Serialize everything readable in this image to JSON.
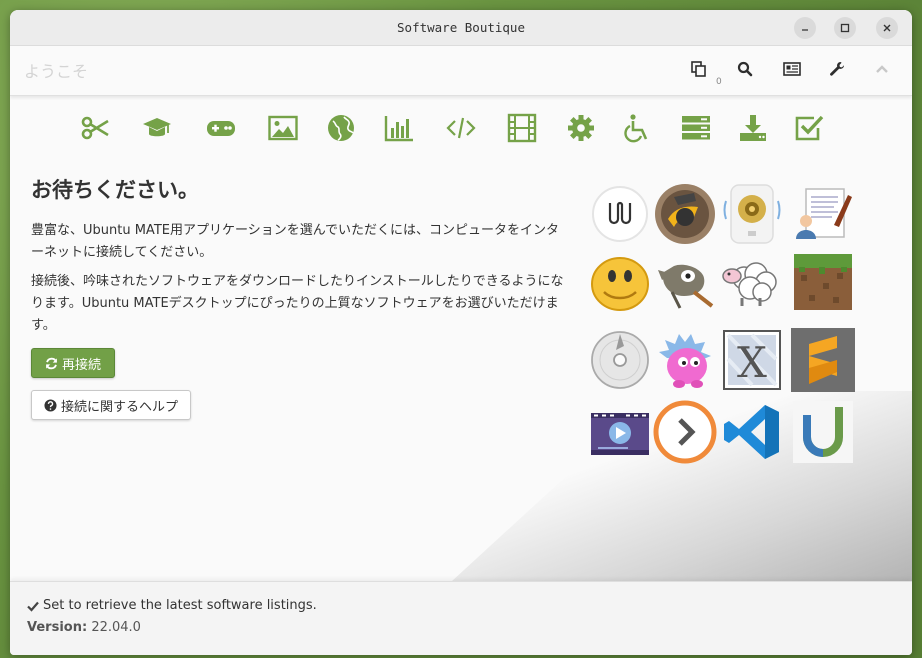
{
  "window": {
    "title": "Software Boutique"
  },
  "toolbar": {
    "page_title": "ようこそ",
    "queue_count": "0",
    "icons": [
      "queue-icon",
      "search-icon",
      "news-icon",
      "preferences-icon",
      "chevron-up-icon"
    ]
  },
  "categories": [
    {
      "name": "accessories",
      "icon": "scissors-icon"
    },
    {
      "name": "education",
      "icon": "graduation-cap-icon"
    },
    {
      "name": "games",
      "icon": "gamepad-icon"
    },
    {
      "name": "graphics",
      "icon": "picture-icon"
    },
    {
      "name": "internet",
      "icon": "globe-icon"
    },
    {
      "name": "office",
      "icon": "bar-chart-icon"
    },
    {
      "name": "programming",
      "icon": "code-icon"
    },
    {
      "name": "sound-video",
      "icon": "film-icon"
    },
    {
      "name": "system-tools",
      "icon": "gear-icon"
    },
    {
      "name": "universal-access",
      "icon": "wheelchair-icon"
    },
    {
      "name": "servers",
      "icon": "server-icon"
    },
    {
      "name": "more-software",
      "icon": "download-icon"
    },
    {
      "name": "fixes",
      "icon": "checkbox-icon"
    }
  ],
  "main": {
    "heading": "お待ちください。",
    "paragraph1": "豊富な、Ubuntu MATE用アプリケーションを選んでいただくには、コンピュータをインターネットに接続してください。",
    "paragraph2": "接続後、吟味されたソフトウェアをダウンロードしたりインストールしたりできるようになります。Ubuntu MATEデスクトップにぴったりの上質なソフトウェアをお選びいただけます。",
    "reconnect_label": "再接続",
    "help_label": "接続に関するヘルプ"
  },
  "footer": {
    "status": "Set to retrieve the latest software listings.",
    "version_label": "Version:",
    "version_value": "22.04.0"
  },
  "colors": {
    "accent": "#72a047",
    "icon_green": "#75a248"
  }
}
